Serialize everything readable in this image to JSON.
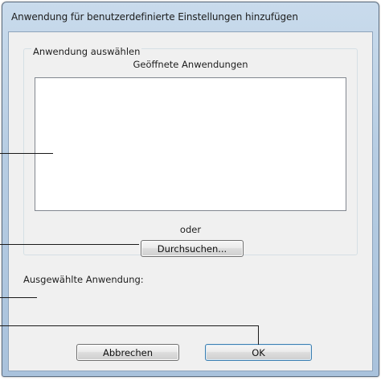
{
  "window": {
    "title": "Anwendung für benutzerdefinierte Einstellungen hinzufügen"
  },
  "group": {
    "caption": "Anwendung auswählen",
    "list_header": "Geöffnete Anwendungen",
    "open_applications": []
  },
  "or_text": "oder",
  "browse_button": "Durchsuchen...",
  "selected_application_label": "Ausgewählte Anwendung:",
  "buttons": {
    "cancel": "Abbrechen",
    "ok": "OK"
  },
  "colors": {
    "frame": "#b7cde3",
    "client": "#f0f0f0",
    "ok_border": "#3c7fb1"
  }
}
